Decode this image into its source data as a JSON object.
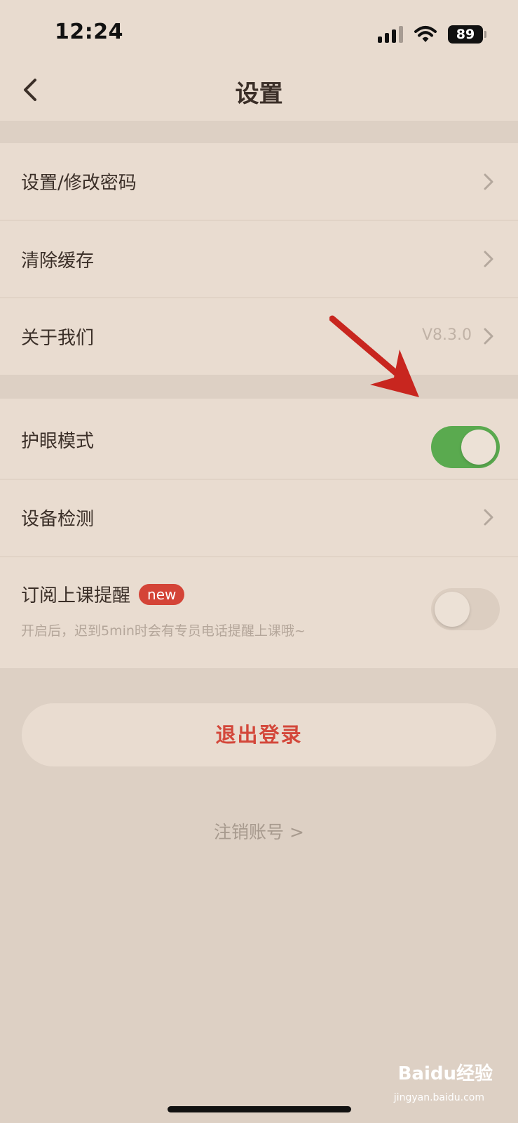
{
  "status_bar": {
    "time": "12:24",
    "battery": "89"
  },
  "nav": {
    "title": "设置"
  },
  "group1": {
    "items": [
      {
        "label": "设置/修改密码"
      },
      {
        "label": "清除缓存"
      },
      {
        "label": "关于我们",
        "value": "V8.3.0"
      }
    ]
  },
  "group2": {
    "eye_mode": {
      "label": "护眼模式",
      "enabled": true
    },
    "device_check": {
      "label": "设备检测"
    },
    "class_reminder": {
      "label": "订阅上课提醒",
      "badge": "new",
      "description": "开启后，迟到5min时会有专员电话提醒上课哦~",
      "enabled": false
    }
  },
  "logout_label": "退出登录",
  "cancel_account_label": "注销账号 >",
  "watermark": {
    "text": "Baidu经验",
    "sub": "jingyan.baidu.com"
  },
  "colors": {
    "background": "#ddd0c4",
    "card": "#e9dcd0",
    "toggle_on": "#5aaa4f",
    "accent_red": "#d3473a",
    "annotation_arrow": "#c8261f"
  }
}
